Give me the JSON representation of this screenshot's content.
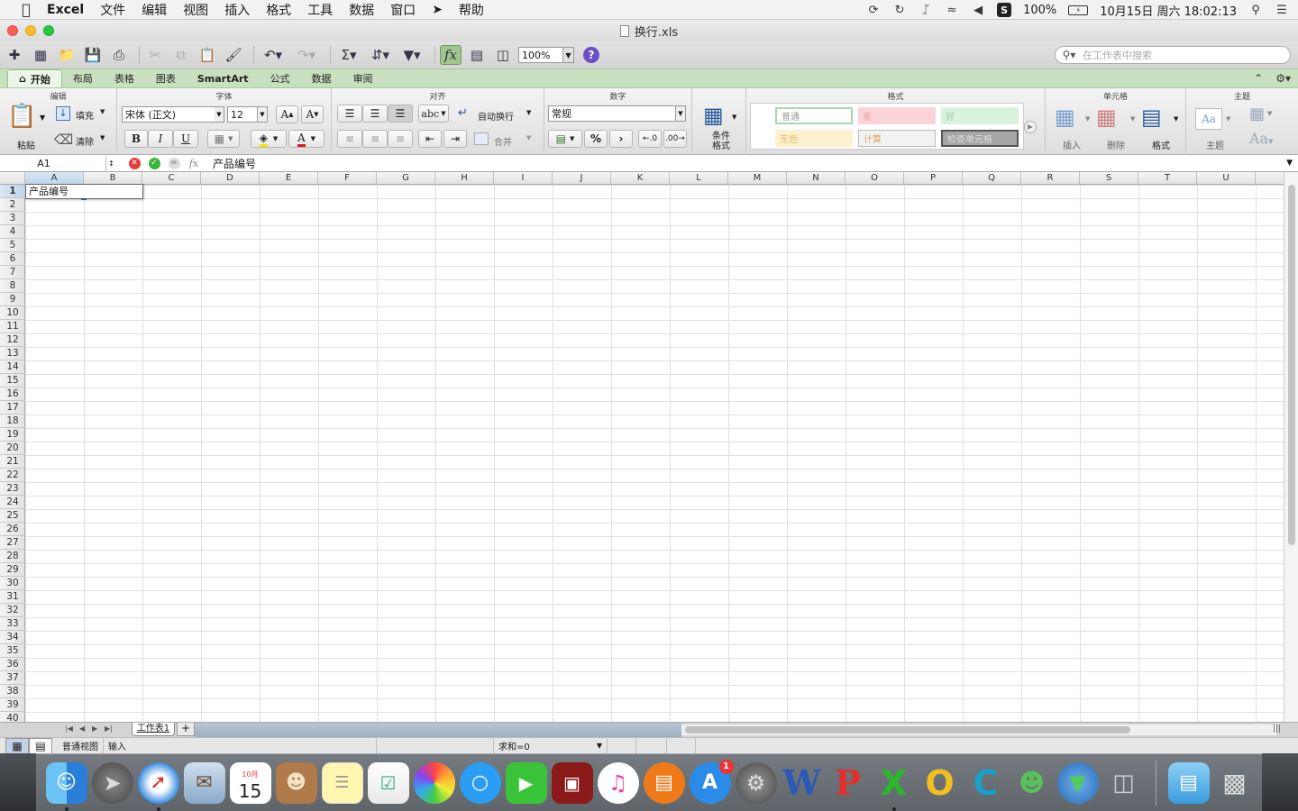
{
  "menubar": {
    "app": "Excel",
    "menus": [
      "文件",
      "编辑",
      "视图",
      "插入",
      "格式",
      "工具",
      "数据",
      "窗口",
      "帮助"
    ],
    "battery": "100%",
    "datetime": "10月15日 周六  18:02:13"
  },
  "window": {
    "title": "换行.xls"
  },
  "toolbar": {
    "zoom": "100%",
    "search_placeholder": "在工作表中搜索",
    "fx_label": "fx"
  },
  "ribbon": {
    "tabs": [
      "开始",
      "布局",
      "表格",
      "图表",
      "SmartArt",
      "公式",
      "数据",
      "审阅"
    ],
    "groups": {
      "edit": "编辑",
      "font": "字体",
      "align": "对齐",
      "number": "数字",
      "format": "格式",
      "cells": "单元格",
      "theme": "主题"
    },
    "paste_label": "粘贴",
    "fill_label": "填充",
    "clear_label": "清除",
    "font_name": "宋体 (正文)",
    "font_size": "12",
    "wrap_label": "自动换行",
    "merge_label": "合并",
    "abc_label": "abc",
    "number_format": "常规",
    "percent": "%",
    "comma": "›",
    "cond_format_label": "条件格式",
    "styles": [
      "普通",
      "差",
      "好",
      "无色",
      "计算",
      "检查单元格"
    ],
    "insert_label": "插入",
    "delete_label": "删除",
    "format_label": "格式",
    "theme_label": "主题",
    "bold": "B",
    "italic": "I",
    "underline": "U",
    "font_grow": "A",
    "font_shrink": "A",
    "theme_aa": "Aa"
  },
  "formula_bar": {
    "name_box": "A1",
    "fx": "fx",
    "content": "产品编号"
  },
  "sheet": {
    "columns": [
      "A",
      "B",
      "C",
      "D",
      "E",
      "F",
      "G",
      "H",
      "I",
      "J",
      "K",
      "L",
      "M",
      "N",
      "O",
      "P",
      "Q",
      "R",
      "S",
      "T",
      "U"
    ],
    "rows": [
      "1",
      "2",
      "3",
      "4",
      "5",
      "6",
      "7",
      "8",
      "9",
      "10",
      "11",
      "12",
      "13",
      "14",
      "15",
      "16",
      "17",
      "18",
      "19",
      "20",
      "21",
      "22",
      "23",
      "24",
      "25",
      "26",
      "27",
      "28",
      "29",
      "30",
      "31",
      "32",
      "33",
      "34",
      "35",
      "36",
      "37",
      "38",
      "39",
      "40"
    ],
    "active_cell_value": "产品编号",
    "tab_name": "工作表1",
    "add_tab": "+"
  },
  "statusbar": {
    "view_label": "普通视图",
    "mode": "输入",
    "sum": "求和=0"
  },
  "dock": {
    "calendar_month": "10月",
    "calendar_day": "15",
    "appstore_badge": "1"
  }
}
